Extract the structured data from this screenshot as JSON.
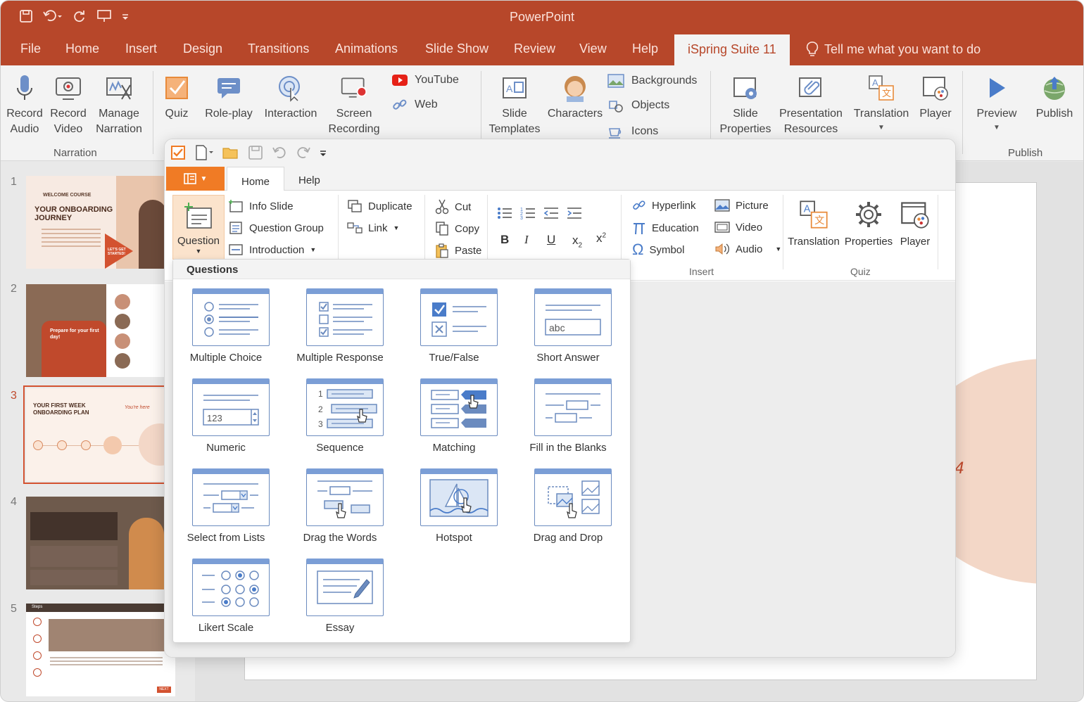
{
  "app": {
    "title": "PowerPoint"
  },
  "pp_tabs": [
    {
      "label": "File"
    },
    {
      "label": "Home"
    },
    {
      "label": "Insert"
    },
    {
      "label": "Design"
    },
    {
      "label": "Transitions"
    },
    {
      "label": "Animations"
    },
    {
      "label": "Slide Show"
    },
    {
      "label": "Review"
    },
    {
      "label": "View"
    },
    {
      "label": "Help"
    },
    {
      "label": "iSpring Suite 11"
    }
  ],
  "tell_me": "Tell me what you want to do",
  "pp_ribbon": {
    "record_audio": "Record Audio",
    "record_video": "Record Video",
    "manage_narration": "Manage Narration",
    "narration_group": "Narration",
    "quiz": "Quiz",
    "role_play": "Role-play",
    "interaction": "Interaction",
    "screen_recording": "Screen Recording",
    "youtube": "YouTube",
    "web": "Web",
    "slide_templates": "Slide Templates",
    "characters": "Characters",
    "backgrounds": "Backgrounds",
    "objects": "Objects",
    "icons": "Icons",
    "slide_properties": "Slide Properties",
    "presentation_resources": "Presentation Resources",
    "translation": "Translation",
    "player": "Player",
    "preview": "Preview",
    "publish": "Publish",
    "publish_group": "Publish"
  },
  "slides": [
    {
      "num": "1",
      "kicker": "WELCOME COURSE",
      "title": "YOUR ONBOARDING JOURNEY",
      "cta": "LET'S GET STARTED!"
    },
    {
      "num": "2",
      "title": "Prepare for your first day!"
    },
    {
      "num": "3",
      "title": "YOUR FIRST WEEK ONBOARDING PLAN",
      "note": "You're here"
    },
    {
      "num": "4"
    },
    {
      "num": "5",
      "title": "Steps",
      "button": "NEXT"
    }
  ],
  "isp_tabs": {
    "home": "Home",
    "help": "Help"
  },
  "isp_ribbon": {
    "question": "Question",
    "info_slide": "Info Slide",
    "question_group": "Question Group",
    "introduction": "Introduction",
    "duplicate": "Duplicate",
    "link": "Link",
    "cut": "Cut",
    "copy": "Copy",
    "paste": "Paste",
    "hyperlink": "Hyperlink",
    "education": "Education",
    "symbol": "Symbol",
    "picture": "Picture",
    "video": "Video",
    "audio": "Audio",
    "insert_group": "Insert",
    "translation": "Translation",
    "properties": "Properties",
    "player": "Player",
    "quiz_group": "Quiz"
  },
  "questions_menu": {
    "title": "Questions",
    "items": [
      {
        "label": "Multiple Choice",
        "icon": "multiple-choice-icon"
      },
      {
        "label": "Multiple Response",
        "icon": "multiple-response-icon"
      },
      {
        "label": "True/False",
        "icon": "true-false-icon"
      },
      {
        "label": "Short Answer",
        "icon": "short-answer-icon",
        "sample": "abc"
      },
      {
        "label": "Numeric",
        "icon": "numeric-icon",
        "sample": "123"
      },
      {
        "label": "Sequence",
        "icon": "sequence-icon",
        "numbers": [
          "1",
          "2",
          "3"
        ]
      },
      {
        "label": "Matching",
        "icon": "matching-icon"
      },
      {
        "label": "Fill in the Blanks",
        "icon": "fill-blanks-icon"
      },
      {
        "label": "Select from Lists",
        "icon": "select-lists-icon"
      },
      {
        "label": "Drag the Words",
        "icon": "drag-words-icon"
      },
      {
        "label": "Hotspot",
        "icon": "hotspot-icon"
      },
      {
        "label": "Drag and Drop",
        "icon": "drag-drop-icon"
      },
      {
        "label": "Likert Scale",
        "icon": "likert-icon"
      },
      {
        "label": "Essay",
        "icon": "essay-icon"
      }
    ]
  },
  "colors": {
    "accent": "#b7472a",
    "ispring_orange": "#f07b25",
    "icon_blue": "#7b9ed6"
  }
}
